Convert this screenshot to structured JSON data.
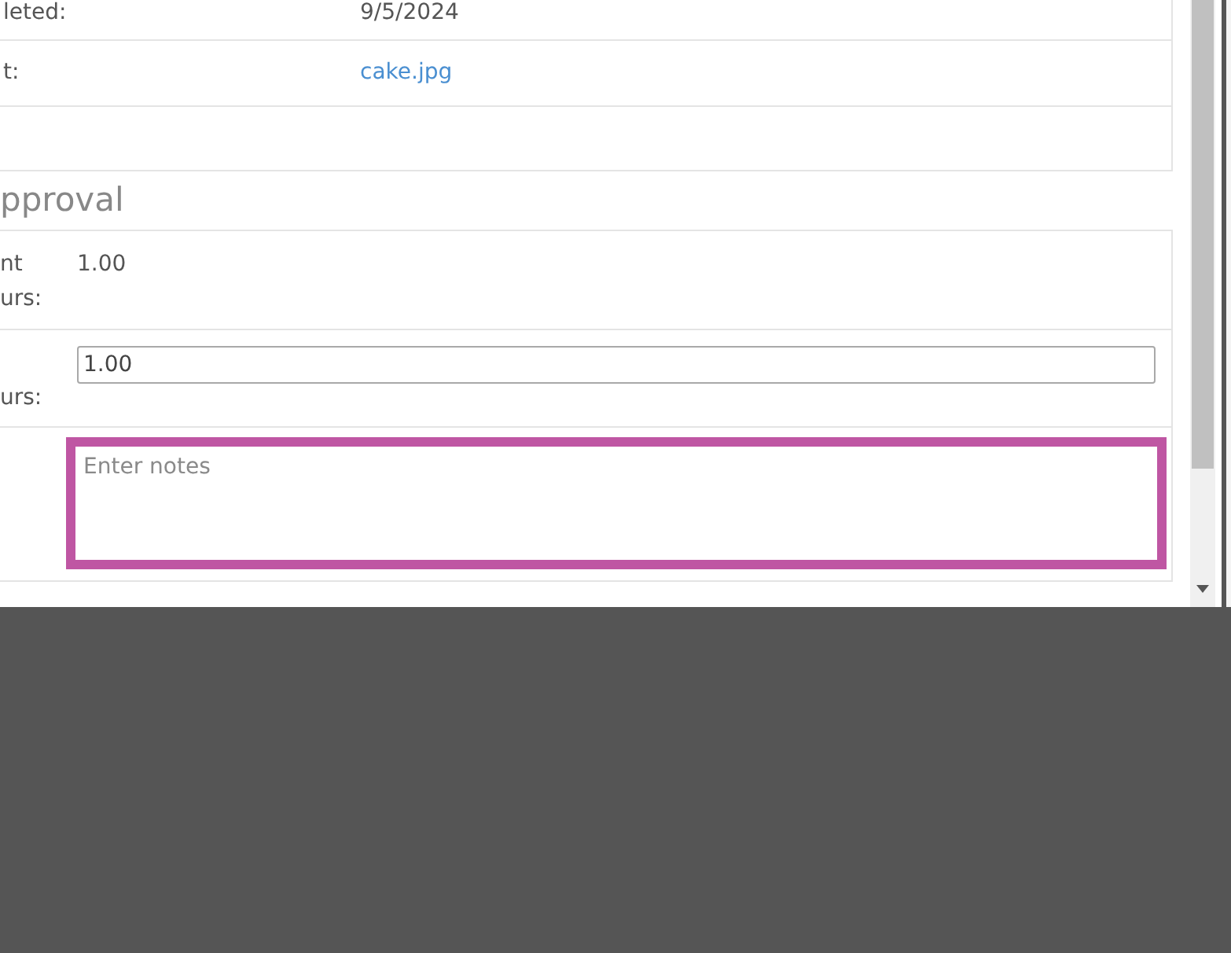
{
  "details": {
    "rows": [
      {
        "label": "leted:",
        "value": "9/5/2024",
        "kind": "text"
      },
      {
        "label": "t:",
        "value": "cake.jpg",
        "kind": "link"
      },
      {
        "kind": "empty"
      }
    ]
  },
  "approval": {
    "heading": "pproval",
    "rows": [
      {
        "label": "nt urs:",
        "value": "1.00",
        "kind": "text"
      },
      {
        "label": "urs:",
        "value": "1.00",
        "kind": "input"
      },
      {
        "placeholder": "Enter notes",
        "kind": "textarea",
        "focused": true
      }
    ]
  }
}
